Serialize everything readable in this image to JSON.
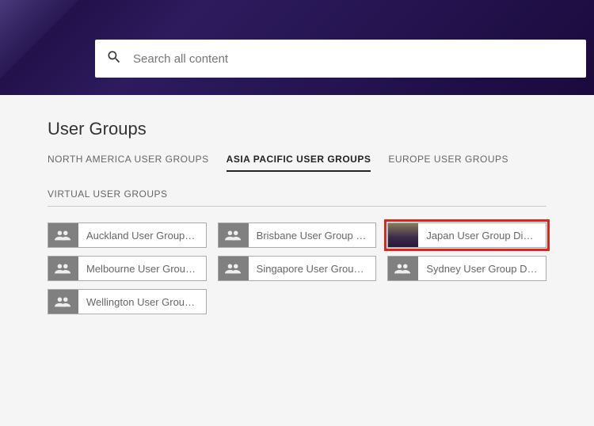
{
  "search": {
    "placeholder": "Search all content"
  },
  "page": {
    "title": "User Groups"
  },
  "tabs": [
    {
      "label": "NORTH AMERICA USER GROUPS",
      "active": false
    },
    {
      "label": "ASIA PACIFIC USER GROUPS",
      "active": true
    },
    {
      "label": "EUROPE USER GROUPS",
      "active": false
    },
    {
      "label": "VIRTUAL USER GROUPS",
      "active": false
    }
  ],
  "groups": [
    {
      "label": "Auckland User Group D...",
      "highlighted": false,
      "photo": false
    },
    {
      "label": "Brisbane User Group Di...",
      "highlighted": false,
      "photo": false
    },
    {
      "label": "Japan User Group Discu...",
      "highlighted": true,
      "photo": true
    },
    {
      "label": "Melbourne User Group ...",
      "highlighted": false,
      "photo": false
    },
    {
      "label": "Singapore User Group ...",
      "highlighted": false,
      "photo": false
    },
    {
      "label": "Sydney User Group Disc...",
      "highlighted": false,
      "photo": false
    },
    {
      "label": "Wellington User Group ...",
      "highlighted": false,
      "photo": false
    }
  ],
  "colors": {
    "highlight": "#e2231a",
    "banner": "#1a0a3d"
  }
}
